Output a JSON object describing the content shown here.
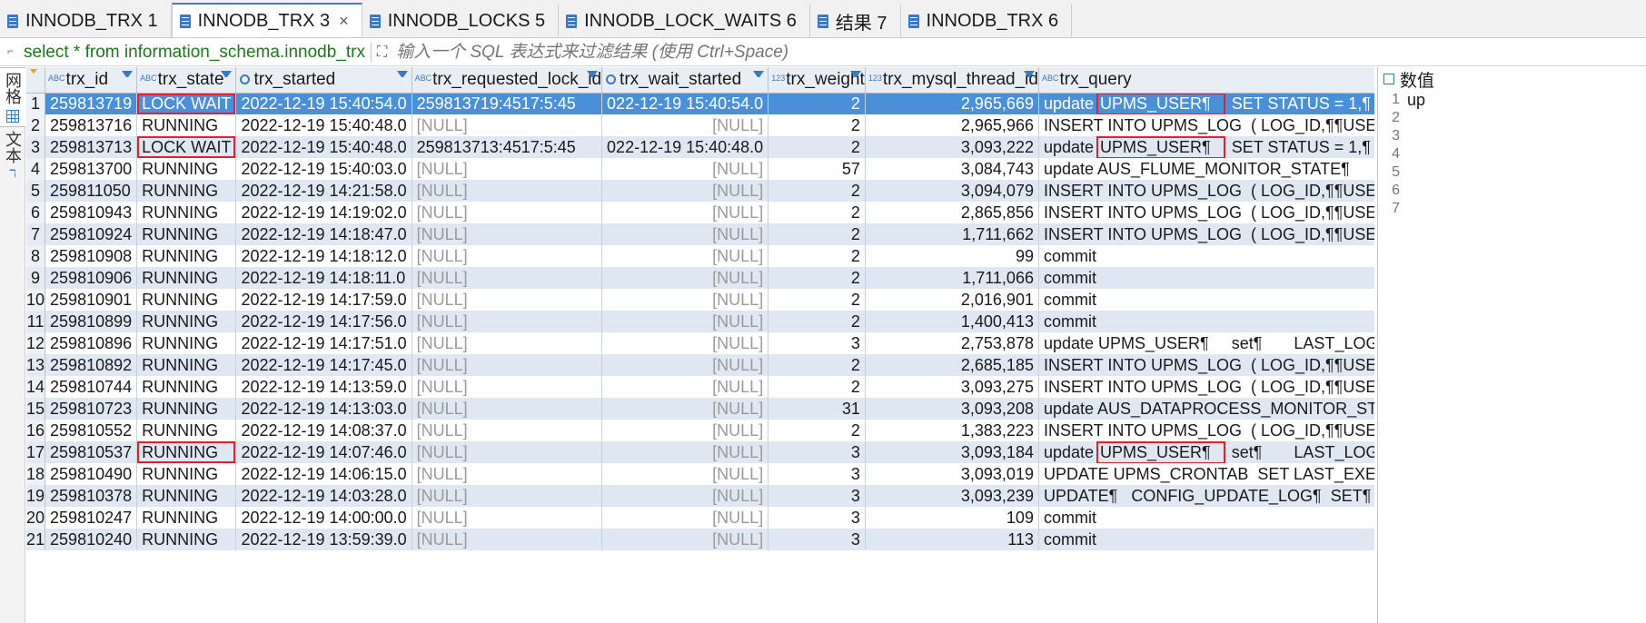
{
  "tabs": [
    {
      "label": "INNODB_TRX 1",
      "active": false
    },
    {
      "label": "INNODB_TRX 3",
      "active": true,
      "closable": true
    },
    {
      "label": "INNODB_LOCKS 5",
      "active": false
    },
    {
      "label": "INNODB_LOCK_WAITS 6",
      "active": false
    },
    {
      "label": "结果 7",
      "active": false
    },
    {
      "label": "INNODB_TRX 6",
      "active": false
    }
  ],
  "filter": {
    "query": "select * from information_schema.innodb_trx",
    "placeholder": "输入一个 SQL 表达式来过滤结果 (使用 Ctrl+Space)"
  },
  "modes": [
    {
      "label": "网格",
      "icon": "grid-icon",
      "active": true
    },
    {
      "label": "文本",
      "icon": "text-icon",
      "active": false
    }
  ],
  "columns": [
    {
      "label": "trx_id",
      "type": "abc"
    },
    {
      "label": "trx_state",
      "type": "abc"
    },
    {
      "label": "trx_started",
      "type": "clock"
    },
    {
      "label": "trx_requested_lock_id",
      "type": "abc"
    },
    {
      "label": "trx_wait_started",
      "type": "clock"
    },
    {
      "label": "trx_weight",
      "type": "123"
    },
    {
      "label": "trx_mysql_thread_id",
      "type": "123"
    },
    {
      "label": "trx_query",
      "type": "abc"
    }
  ],
  "rows": [
    {
      "n": "1",
      "trx_id": "259813719",
      "state": "LOCK WAIT",
      "started": "2022-12-19 15:40:54.0",
      "lock_id": "259813719:4517:5:45",
      "wait_started": "022-12-19 15:40:54.0",
      "weight": "2",
      "thread_id": "2,965,669",
      "query_hl": "UPMS_USER¶",
      "query_pre": "update ",
      "query_post": " SET STATUS = 1,¶      ¶"
    },
    {
      "n": "2",
      "trx_id": "259813716",
      "state": "RUNNING",
      "started": "2022-12-19 15:40:48.0",
      "lock_id": "[NULL]",
      "wait_started": "[NULL]",
      "weight": "2",
      "thread_id": "2,965,966",
      "query_pre": "INSERT INTO UPMS_LOG  ( LOG_ID,¶¶USERNAME,",
      "query_hl": "",
      "query_post": ""
    },
    {
      "n": "3",
      "trx_id": "259813713",
      "state": "LOCK WAIT",
      "started": "2022-12-19 15:40:48.0",
      "lock_id": "259813713:4517:5:45",
      "wait_started": "022-12-19 15:40:48.0",
      "weight": "2",
      "thread_id": "3,093,222",
      "query_hl": "UPMS_USER¶",
      "query_pre": "update ",
      "query_post": " SET STATUS = 1,¶      ¶"
    },
    {
      "n": "4",
      "trx_id": "259813700",
      "state": "RUNNING",
      "started": "2022-12-19 15:40:03.0",
      "lock_id": "[NULL]",
      "wait_started": "[NULL]",
      "weight": "57",
      "thread_id": "3,084,743",
      "query_pre": "update AUS_FLUME_MONITOR_STATE¶       set `S",
      "query_hl": "",
      "query_post": ""
    },
    {
      "n": "5",
      "trx_id": "259811050",
      "state": "RUNNING",
      "started": "2022-12-19 14:21:58.0",
      "lock_id": "[NULL]",
      "wait_started": "[NULL]",
      "weight": "2",
      "thread_id": "3,094,079",
      "query_pre": "INSERT INTO UPMS_LOG  ( LOG_ID,¶¶USERNAME,",
      "query_hl": "",
      "query_post": ""
    },
    {
      "n": "6",
      "trx_id": "259810943",
      "state": "RUNNING",
      "started": "2022-12-19 14:19:02.0",
      "lock_id": "[NULL]",
      "wait_started": "[NULL]",
      "weight": "2",
      "thread_id": "2,865,856",
      "query_pre": "INSERT INTO UPMS_LOG  ( LOG_ID,¶¶USERNAME,",
      "query_hl": "",
      "query_post": ""
    },
    {
      "n": "7",
      "trx_id": "259810924",
      "state": "RUNNING",
      "started": "2022-12-19 14:18:47.0",
      "lock_id": "[NULL]",
      "wait_started": "[NULL]",
      "weight": "2",
      "thread_id": "1,711,662",
      "query_pre": "INSERT INTO UPMS_LOG  ( LOG_ID,¶¶USERNAME,",
      "query_hl": "",
      "query_post": ""
    },
    {
      "n": "8",
      "trx_id": "259810908",
      "state": "RUNNING",
      "started": "2022-12-19 14:18:12.0",
      "lock_id": "[NULL]",
      "wait_started": "[NULL]",
      "weight": "2",
      "thread_id": "99",
      "query_pre": "commit",
      "query_hl": "",
      "query_post": ""
    },
    {
      "n": "9",
      "trx_id": "259810906",
      "state": "RUNNING",
      "started": "2022-12-19 14:18:11.0",
      "lock_id": "[NULL]",
      "wait_started": "[NULL]",
      "weight": "2",
      "thread_id": "1,711,066",
      "query_pre": "commit",
      "query_hl": "",
      "query_post": ""
    },
    {
      "n": "10",
      "trx_id": "259810901",
      "state": "RUNNING",
      "started": "2022-12-19 14:17:59.0",
      "lock_id": "[NULL]",
      "wait_started": "[NULL]",
      "weight": "2",
      "thread_id": "2,016,901",
      "query_pre": "commit",
      "query_hl": "",
      "query_post": ""
    },
    {
      "n": "11",
      "trx_id": "259810899",
      "state": "RUNNING",
      "started": "2022-12-19 14:17:56.0",
      "lock_id": "[NULL]",
      "wait_started": "[NULL]",
      "weight": "2",
      "thread_id": "1,400,413",
      "query_pre": "commit",
      "query_hl": "",
      "query_post": ""
    },
    {
      "n": "12",
      "trx_id": "259810896",
      "state": "RUNNING",
      "started": "2022-12-19 14:17:51.0",
      "lock_id": "[NULL]",
      "wait_started": "[NULL]",
      "weight": "3",
      "thread_id": "2,753,878",
      "query_pre": "update UPMS_USER¶     set¶       LAST_LOGIN_IP = '",
      "query_hl": "",
      "query_post": ""
    },
    {
      "n": "13",
      "trx_id": "259810892",
      "state": "RUNNING",
      "started": "2022-12-19 14:17:45.0",
      "lock_id": "[NULL]",
      "wait_started": "[NULL]",
      "weight": "2",
      "thread_id": "2,685,185",
      "query_pre": "INSERT INTO UPMS_LOG  ( LOG_ID,¶¶USERNAME,",
      "query_hl": "",
      "query_post": ""
    },
    {
      "n": "14",
      "trx_id": "259810744",
      "state": "RUNNING",
      "started": "2022-12-19 14:13:59.0",
      "lock_id": "[NULL]",
      "wait_started": "[NULL]",
      "weight": "2",
      "thread_id": "3,093,275",
      "query_pre": "INSERT INTO UPMS_LOG  ( LOG_ID,¶¶USERNAME,",
      "query_hl": "",
      "query_post": ""
    },
    {
      "n": "15",
      "trx_id": "259810723",
      "state": "RUNNING",
      "started": "2022-12-19 14:13:03.0",
      "lock_id": "[NULL]",
      "wait_started": "[NULL]",
      "weight": "31",
      "thread_id": "3,093,208",
      "query_pre": "update AUS_DATAPROCESS_MONITOR_STATE¶",
      "query_hl": "",
      "query_post": ""
    },
    {
      "n": "16",
      "trx_id": "259810552",
      "state": "RUNNING",
      "started": "2022-12-19 14:08:37.0",
      "lock_id": "[NULL]",
      "wait_started": "[NULL]",
      "weight": "2",
      "thread_id": "1,383,223",
      "query_pre": "INSERT INTO UPMS_LOG  ( LOG_ID,¶¶USERNAME,",
      "query_hl": "",
      "query_post": ""
    },
    {
      "n": "17",
      "trx_id": "259810537",
      "state": "RUNNING",
      "started": "2022-12-19 14:07:46.0",
      "lock_id": "[NULL]",
      "wait_started": "[NULL]",
      "weight": "3",
      "thread_id": "3,093,184",
      "query_hl": "UPMS_USER¶",
      "query_pre": "update ",
      "query_post": " set¶       LAST_LOGIN_IP = '"
    },
    {
      "n": "18",
      "trx_id": "259810490",
      "state": "RUNNING",
      "started": "2022-12-19 14:06:15.0",
      "lock_id": "[NULL]",
      "wait_started": "[NULL]",
      "weight": "3",
      "thread_id": "3,093,019",
      "query_pre": "UPDATE UPMS_CRONTAB  SET LAST_EXEC_TIME=",
      "query_hl": "",
      "query_post": ""
    },
    {
      "n": "19",
      "trx_id": "259810378",
      "state": "RUNNING",
      "started": "2022-12-19 14:03:28.0",
      "lock_id": "[NULL]",
      "wait_started": "[NULL]",
      "weight": "3",
      "thread_id": "3,093,239",
      "query_pre": "UPDATE¶   CONFIG_UPDATE_LOG¶  SET¶   UPDAT",
      "query_hl": "",
      "query_post": ""
    },
    {
      "n": "20",
      "trx_id": "259810247",
      "state": "RUNNING",
      "started": "2022-12-19 14:00:00.0",
      "lock_id": "[NULL]",
      "wait_started": "[NULL]",
      "weight": "3",
      "thread_id": "109",
      "query_pre": "commit",
      "query_hl": "",
      "query_post": ""
    },
    {
      "n": "21",
      "trx_id": "259810240",
      "state": "RUNNING",
      "started": "2022-12-19 13:59:39.0",
      "lock_id": "[NULL]",
      "wait_started": "[NULL]",
      "weight": "3",
      "thread_id": "113",
      "query_pre": "commit",
      "query_hl": "",
      "query_post": ""
    }
  ],
  "highlighted_state_rows": [
    1,
    3,
    17
  ],
  "selected_row": 1,
  "right_panel": {
    "title": "数值",
    "line_numbers": [
      "1",
      "2",
      "3",
      "4",
      "5",
      "6",
      "7"
    ],
    "value_text": "up"
  },
  "colors": {
    "selection": "#4a90d9",
    "highlight_box": "#e0202a",
    "alt_row": "#dfe7f2",
    "null_text": "#9a9a9a"
  }
}
